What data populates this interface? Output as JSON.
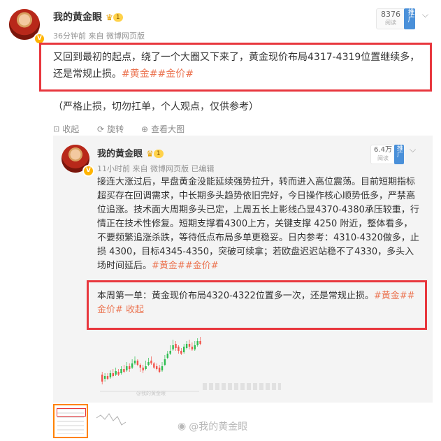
{
  "post": {
    "author": "我的黄金眼",
    "level_badge": "1",
    "time": "36分钟前",
    "source_prefix": "来自",
    "source": "微博网页版",
    "read_count": "8376",
    "read_label": "阅读",
    "push_label": "推广",
    "text": "又回到最初的起点，绕了一个大圈又下来了，黄金现价布局4317-4319位置继续多，还是常规止损。",
    "tags": [
      "#黄金#",
      "#金价#"
    ],
    "note": "（严格止损，切勿扛单，个人观点，仅供参考）"
  },
  "actions": {
    "collapse": "收起",
    "rotate": "旋转",
    "view_large": "查看大图"
  },
  "repost": {
    "author": "我的黄金眼",
    "level_badge": "1",
    "time": "11小时前",
    "source_prefix": "来自",
    "source": "微博网页版",
    "edited": "已编辑",
    "read_count": "6.4万",
    "read_label": "阅读",
    "push_label": "推广",
    "text": "接连大涨过后，早盘黄金没能延续强势拉升，转而进入高位震荡。目前短期指标超买存在回调需求，中长期多头趋势依旧完好，今日操作核心顺势低多，严禁高位追涨。技术面大周期多头已定，上周五长上影线凸显4370-4380承压较重，行情正在技术性修复。短期支撑看4300上方，关键支撑 4250 附近，整体看多，不要频繁追涨杀跌，等待低点布局多单更稳妥。日内参考：4310-4320做多，止损 4300，目标4345-4350，突破可续拿；若欧盘迟迟站稳不了4330，多头入场时间延后。",
    "tags": [
      "#黄金#",
      "#金价#"
    ],
    "highlight_text": "本周第一单：黄金现价布局4320-4322位置多一次，还是常规止损。",
    "highlight_tags": [
      "#黄金#",
      "#金价#"
    ],
    "collapse": "收起"
  },
  "watermark": "@我的黄金眼",
  "image_watermark": "@我的黄金眼"
}
